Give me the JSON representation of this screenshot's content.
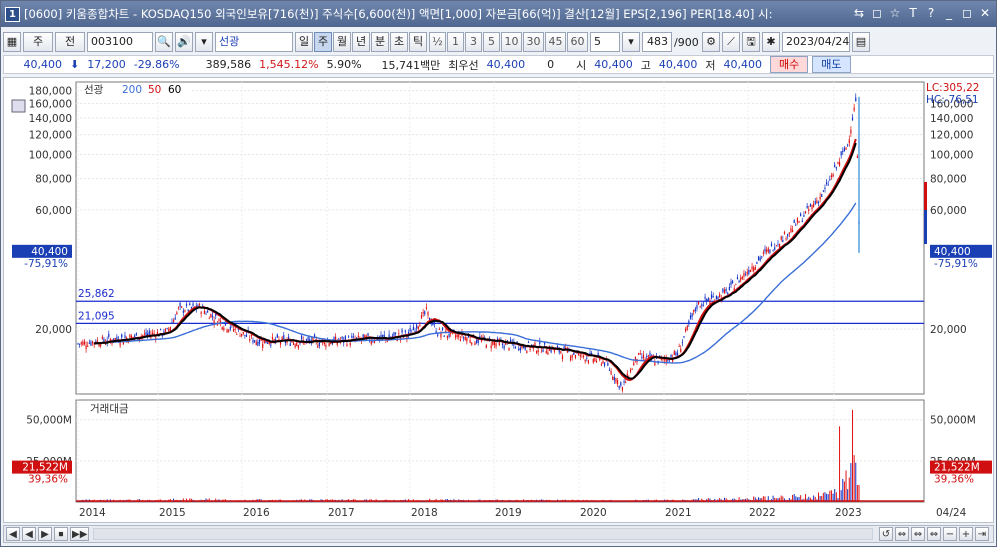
{
  "window": {
    "icon_label": "1",
    "title": "[0600] 키움종합차트 - KOSDAQ150 외국인보유[716(천)] 주식수[6,600(천)] 액면[1,000] 자본금[66(억)] 결산[12월] EPS[2,196] PER[18.40] 시:",
    "controls": [
      "⇆",
      "◻",
      "☆",
      "T",
      "?",
      "_",
      "◻",
      "✕"
    ]
  },
  "toolbar": {
    "market": "주",
    "period_select": "전",
    "code": "003100",
    "stock_name": "선광",
    "period_tabs": [
      "일",
      "주",
      "월",
      "년",
      "분",
      "초",
      "틱"
    ],
    "selected_period": "주",
    "tick_numbers": [
      "½",
      "1",
      "3",
      "5",
      "10",
      "30",
      "45",
      "60"
    ],
    "interval_value": "5",
    "bar_count": "483",
    "bar_total": "/900",
    "date": "2023/04/24"
  },
  "quote": {
    "price": "40,400",
    "change": "17,200",
    "change_pct": "-29.86%",
    "volume": "389,586",
    "volume_ratio": "1,545.12%",
    "turnover": "5.90%",
    "amount": "15,741백만",
    "best_ask_label": "최우선",
    "best_ask": "40,400",
    "best_ask_qty": "0",
    "open_label": "시",
    "open": "40,400",
    "high_label": "고",
    "high": "40,400",
    "low_label": "저",
    "low": "40,400",
    "buy_label": "매수",
    "sell_label": "매도"
  },
  "price_panel": {
    "legend_name": "선광",
    "ma_labels": [
      "200",
      "50",
      "60"
    ],
    "lc_label": "LC:305,22",
    "hc_label": "HC:-76,51",
    "left_price_badge": "40,400",
    "left_pct_badge": "-75,91%",
    "right_price_badge": "40,400",
    "right_pct_badge": "-75,91%",
    "hline1_label": "25,862",
    "hline2_label": "21,095",
    "y_ticks": [
      "180,000",
      "160,000",
      "140,000",
      "120,000",
      "100,000",
      "80,000",
      "60,000",
      "20,000"
    ],
    "right_y_ticks": [
      "160,000",
      "140,000",
      "120,000",
      "100,000",
      "80,000",
      "60,000",
      "20,000"
    ]
  },
  "volume_panel": {
    "legend_name": "거래대금",
    "y_ticks": [
      "50,000M",
      "25,000M"
    ],
    "left_badge": "21,522M",
    "left_pct": "39,36%",
    "right_badge": "21,522M",
    "right_pct": "39,36%"
  },
  "x_axis": {
    "years": [
      "2014",
      "2015",
      "2016",
      "2017",
      "2018",
      "2019",
      "2020",
      "2021",
      "2022",
      "2023"
    ],
    "right_label": "04/24"
  },
  "scroll": {
    "buttons": [
      "◀",
      "◀",
      "▶",
      "⏹",
      "▶▶"
    ],
    "right_buttons": [
      "↺",
      "⇔",
      "⇔",
      "⇔",
      "−",
      "+",
      "⇥"
    ]
  },
  "colors": {
    "up": "#e01010",
    "down": "#1030c8",
    "ma200": "#3a6fd8",
    "ma50": "#d01010",
    "ma60": "#000000"
  }
}
